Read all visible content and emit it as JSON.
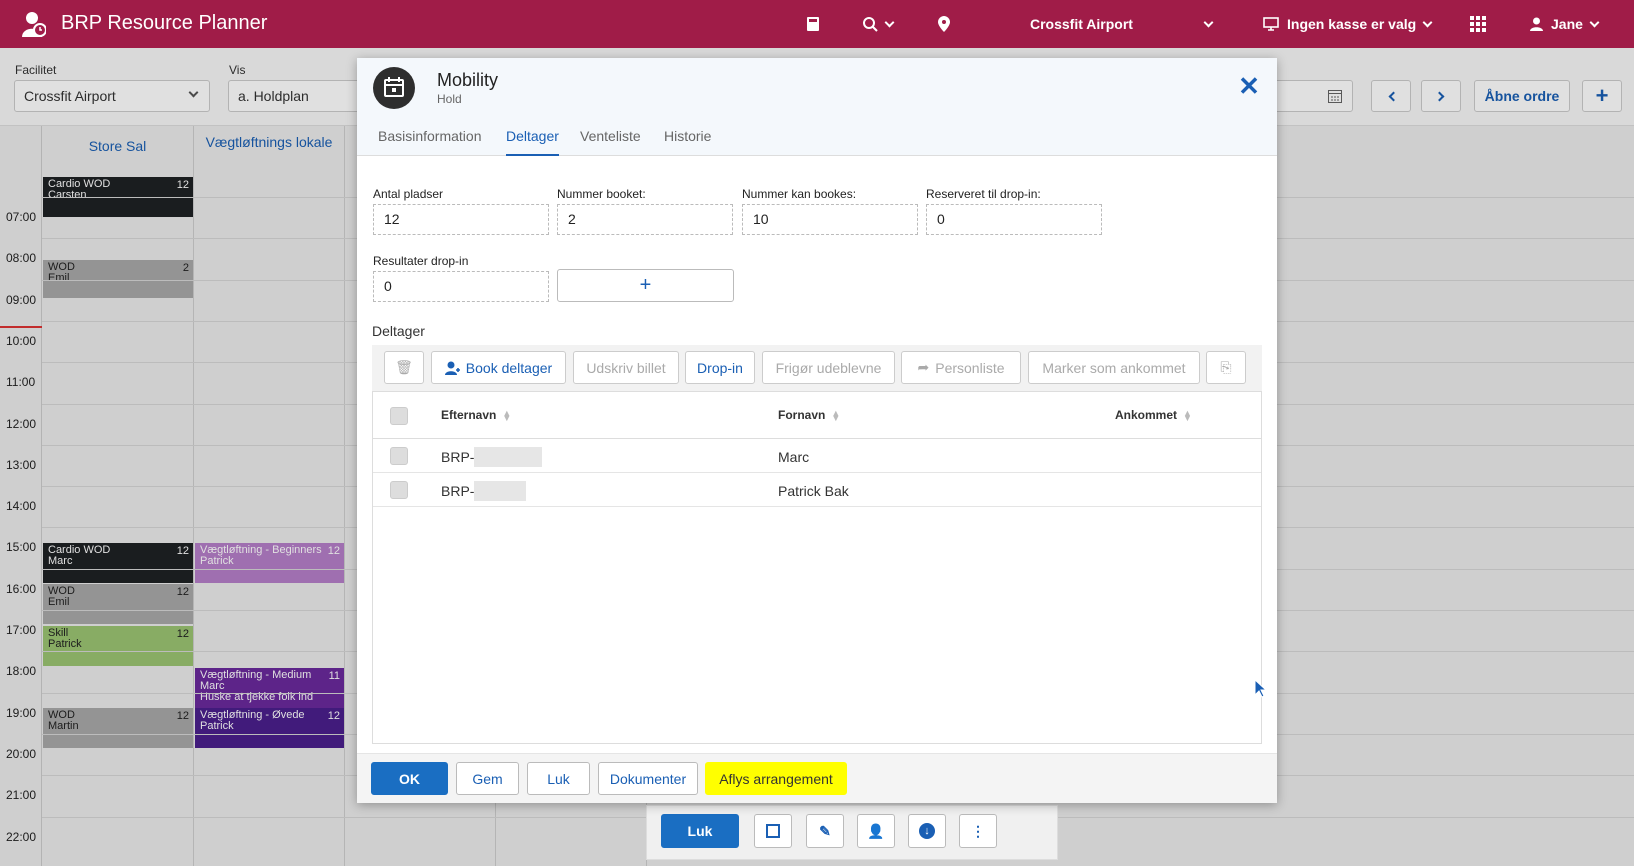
{
  "header": {
    "app_title": "BRP Resource Planner",
    "location": "Crossfit Airport",
    "register": "Ingen kasse er valg",
    "user": "Jane"
  },
  "filters": {
    "facility_label": "Facilitet",
    "facility_value": "Crossfit Airport",
    "view_label": "Vis",
    "view_value": "a. Holdplan",
    "open_orders_label": "Åbne ordre",
    "add_label": "+"
  },
  "calendar": {
    "columns": [
      "Store Sal",
      "Vægtløftnings lokale"
    ],
    "times": [
      "07:00",
      "08:00",
      "09:00",
      "10:00",
      "11:00",
      "12:00",
      "13:00",
      "14:00",
      "15:00",
      "16:00",
      "17:00",
      "18:00",
      "19:00",
      "20:00",
      "21:00",
      "22:00"
    ],
    "events": [
      {
        "title": "Cardio WOD",
        "person": "Carsten",
        "count": "12",
        "color": "#1e2124"
      },
      {
        "title": "WOD",
        "person": "Emil",
        "count": "2",
        "color": "#a9a9a9"
      },
      {
        "title": "Cardio WOD",
        "person": "Marc",
        "count": "12",
        "color": "#1e2124"
      },
      {
        "title": "WOD",
        "person": "Emil",
        "count": "12",
        "color": "#a9a9a9"
      },
      {
        "title": "Skill",
        "person": "Patrick",
        "count": "12",
        "color": "#9bc472"
      },
      {
        "title": "WOD",
        "person": "Martin",
        "count": "12",
        "color": "#a9a9a9"
      },
      {
        "title": "Vægtløftning - Beginners",
        "person": "Patrick",
        "count": "12",
        "color": "#b67fc9"
      },
      {
        "title": "Vægtløftning - Medium",
        "person": "Marc",
        "note": "Huske at tjekke folk ind",
        "count": "11",
        "color": "#6a2a9c"
      },
      {
        "title": "Vægtløftning - Øvede",
        "person": "Patrick",
        "count": "12",
        "color": "#4a1f8c"
      }
    ]
  },
  "modal": {
    "title": "Mobility",
    "subtitle": "Hold",
    "tabs": [
      "Basisinformation",
      "Deltager",
      "Venteliste",
      "Historie"
    ],
    "active_tab": "Deltager",
    "fields": {
      "antal_pladser_label": "Antal pladser",
      "antal_pladser": "12",
      "nummer_booket_label": "Nummer booket:",
      "nummer_booket": "2",
      "nummer_kan_bookes_label": "Nummer kan bookes:",
      "nummer_kan_bookes": "10",
      "reserveret_label": "Reserveret til drop-in:",
      "reserveret": "0",
      "resultater_label": "Resultater drop-in",
      "resultater": "0",
      "plus": "+"
    },
    "section_label": "Deltager",
    "toolbar": {
      "book": "Book deltager",
      "print": "Udskriv billet",
      "dropin": "Drop-in",
      "release": "Frigør udeblevne",
      "personlist": "Personliste",
      "mark": "Marker som ankommet"
    },
    "table": {
      "headers": [
        "Efternavn",
        "Fornavn",
        "Ankommet"
      ],
      "rows": [
        {
          "lastname": "BRP-",
          "firstname": "Marc"
        },
        {
          "lastname": "BRP-",
          "firstname": "Patrick Bak"
        }
      ]
    },
    "footer": {
      "ok": "OK",
      "save": "Gem",
      "close": "Luk",
      "documents": "Dokumenter",
      "cancel_event": "Aflys arrangement"
    }
  },
  "bottombar": {
    "close": "Luk"
  },
  "colors": {
    "brand": "#a01c48",
    "accent": "#1a5fb4",
    "highlight": "#ffff00"
  }
}
